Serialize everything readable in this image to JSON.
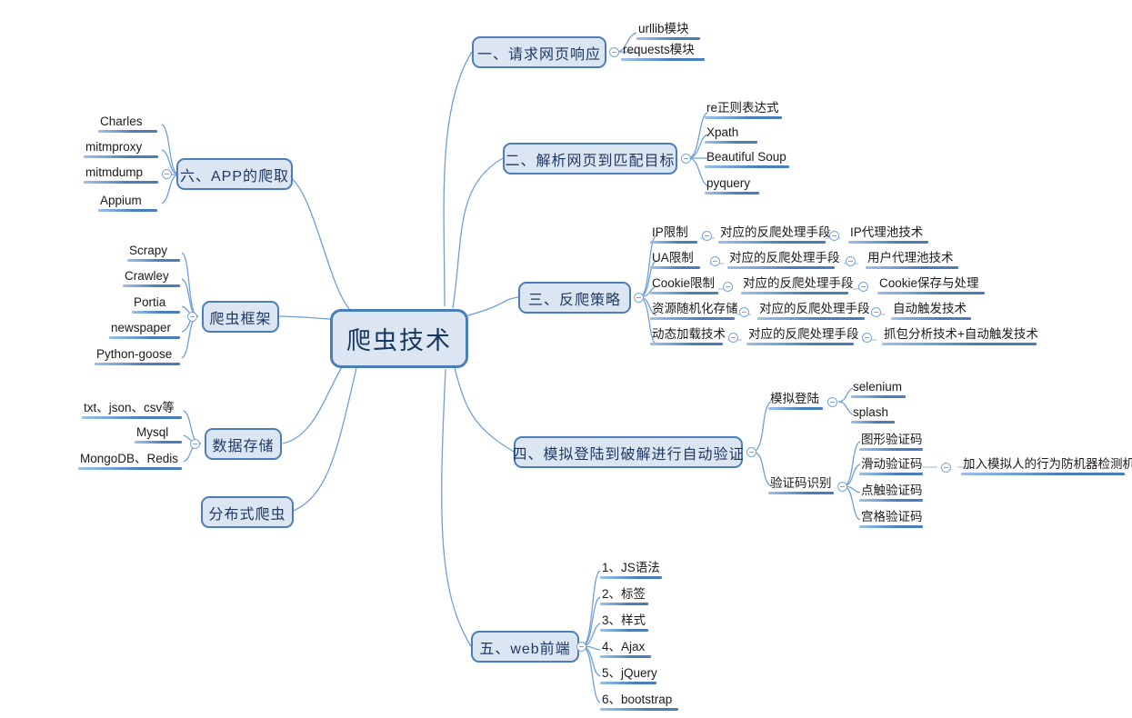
{
  "title": "爬虫技术",
  "theme": {
    "node_fill": "#dce6f2",
    "node_border": "#4a7ebb",
    "node_text": "#1f3864",
    "leaf_text": "#1a1a1a",
    "edge": "#6f9fd8",
    "bar": "#4a7ebb",
    "background": "#ffffff"
  },
  "root": {
    "label": "爬虫技术"
  },
  "branches": {
    "b1": {
      "label": "一、请求网页响应",
      "children": [
        {
          "label": "urllib模块"
        },
        {
          "label": "requests模块"
        }
      ]
    },
    "b2": {
      "label": "二、解析网页到匹配目标",
      "children": [
        {
          "label": "re正则表达式"
        },
        {
          "label": "Xpath"
        },
        {
          "label": "Beautiful Soup"
        },
        {
          "label": "pyquery"
        }
      ]
    },
    "b3": {
      "label": "三、反爬策略",
      "children": [
        {
          "label": "IP限制",
          "mid": "对应的反爬处理手段",
          "leafx": "IP代理池技术"
        },
        {
          "label": "UA限制",
          "mid": "对应的反爬处理手段",
          "leafx": "用户代理池技术"
        },
        {
          "label": "Cookie限制",
          "mid": "对应的反爬处理手段",
          "leafx": "Cookie保存与处理"
        },
        {
          "label": "资源随机化存储",
          "mid": "对应的反爬处理手段",
          "leafx": "自动触发技术"
        },
        {
          "label": "动态加载技术",
          "mid": "对应的反爬处理手段",
          "leafx": "抓包分析技术+自动触发技术"
        }
      ]
    },
    "b4": {
      "label": "四、模拟登陆到破解进行自动验证",
      "children": [
        {
          "label": "模拟登陆",
          "children": [
            {
              "label": "selenium"
            },
            {
              "label": "splash"
            }
          ]
        },
        {
          "label": "验证码识别",
          "children": [
            {
              "label": "图形验证码"
            },
            {
              "label": "滑动验证码",
              "extra": "加入模拟人的行为防机器检测机制"
            },
            {
              "label": "点触验证码"
            },
            {
              "label": "宫格验证码"
            }
          ]
        }
      ]
    },
    "b5": {
      "label": "五、web前端",
      "children": [
        {
          "label": "1、JS语法"
        },
        {
          "label": "2、标签"
        },
        {
          "label": "3、样式"
        },
        {
          "label": "4、Ajax"
        },
        {
          "label": "5、jQuery"
        },
        {
          "label": "6、bootstrap"
        }
      ]
    },
    "b6": {
      "label": "六、APP的爬取",
      "children": [
        {
          "label": "Charles"
        },
        {
          "label": "mitmproxy"
        },
        {
          "label": "mitmdump"
        },
        {
          "label": "Appium"
        }
      ]
    },
    "b7": {
      "label": "爬虫框架",
      "children": [
        {
          "label": "Scrapy"
        },
        {
          "label": "Crawley"
        },
        {
          "label": "Portia"
        },
        {
          "label": "newspaper"
        },
        {
          "label": "Python-goose"
        }
      ]
    },
    "b8": {
      "label": "数据存储",
      "children": [
        {
          "label": "txt、json、csv等"
        },
        {
          "label": "Mysql"
        },
        {
          "label": "MongoDB、Redis"
        }
      ]
    },
    "b9": {
      "label": "分布式爬虫",
      "children": []
    }
  }
}
